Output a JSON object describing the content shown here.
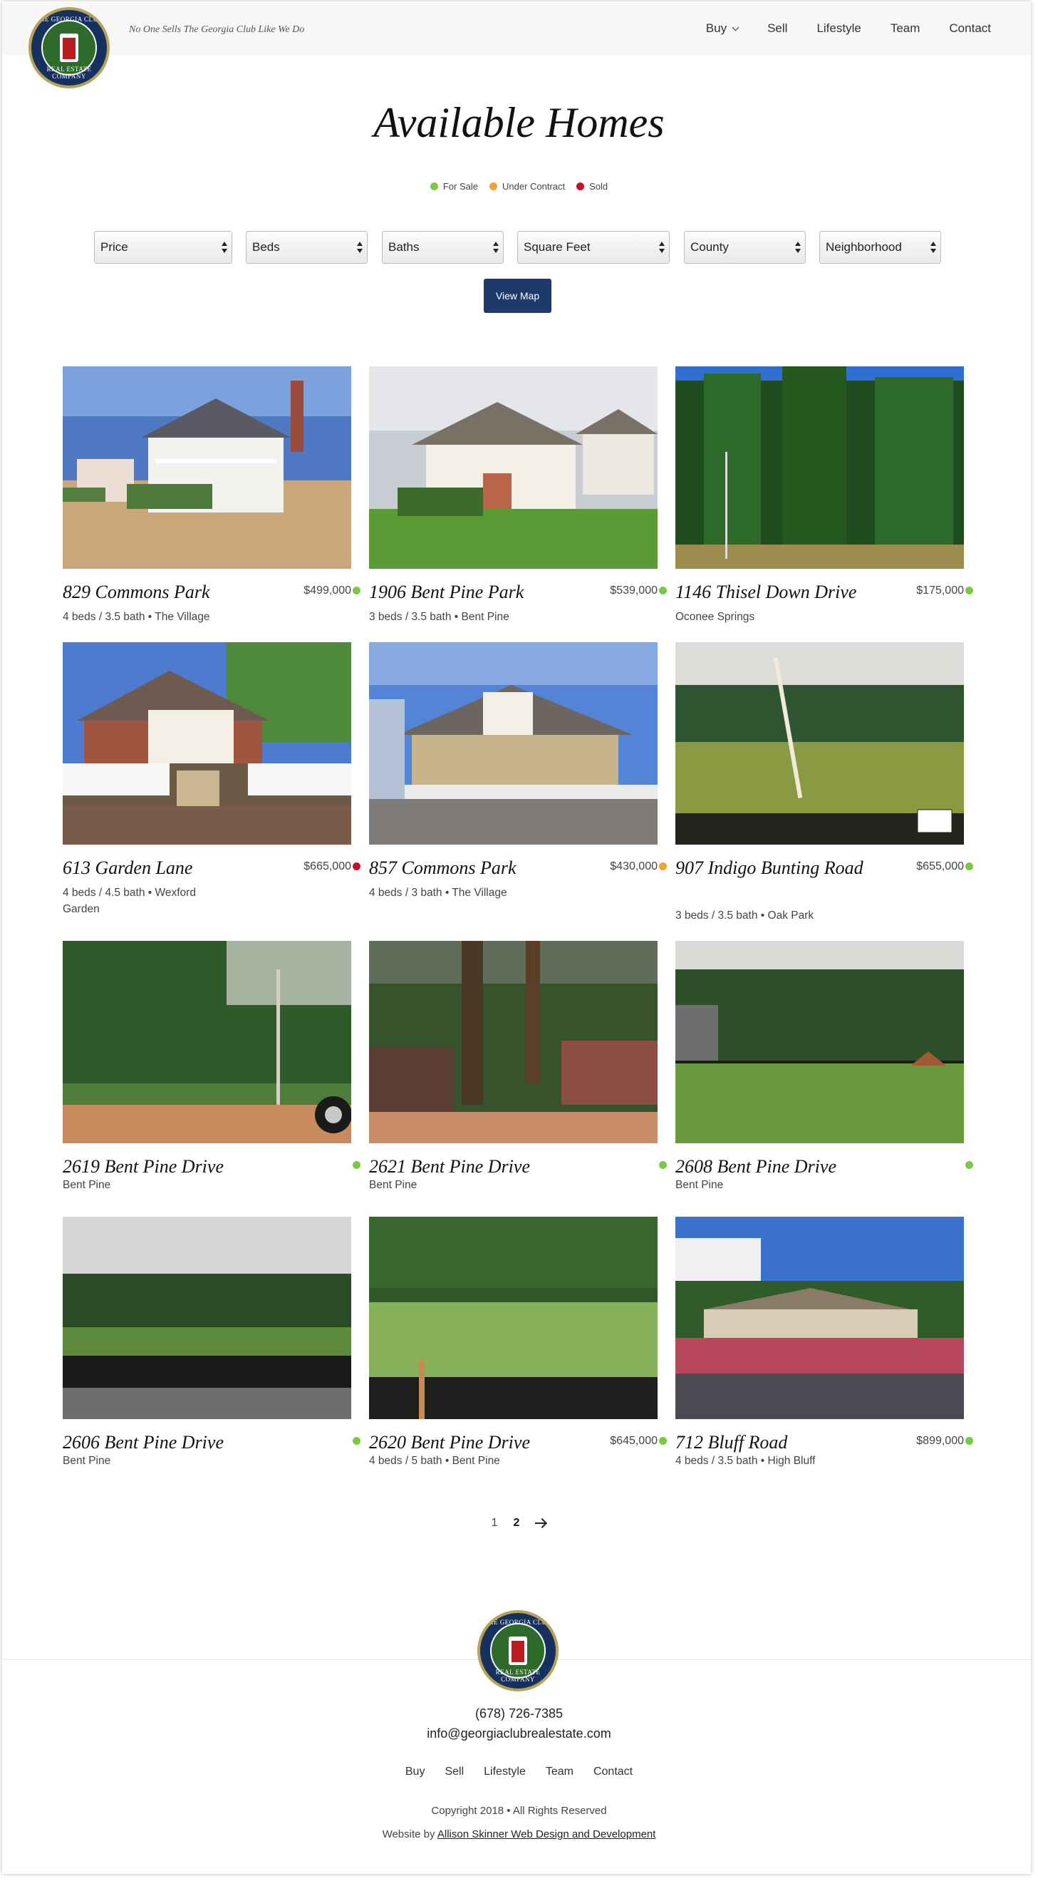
{
  "brand": {
    "logo_text_top": "THE GEORGIA CLUB",
    "logo_text_bottom": "REAL ESTATE COMPANY",
    "tagline": "No One Sells The Georgia Club Like We Do"
  },
  "nav": {
    "items": [
      {
        "label": "Buy",
        "has_dropdown": true
      },
      {
        "label": "Sell"
      },
      {
        "label": "Lifestyle"
      },
      {
        "label": "Team"
      },
      {
        "label": "Contact"
      }
    ]
  },
  "page": {
    "title": "Available Homes"
  },
  "legend": [
    {
      "label": "For Sale",
      "color": "#7ac943"
    },
    {
      "label": "Under Contract",
      "color": "#f0a22e"
    },
    {
      "label": "Sold",
      "color": "#c8102e"
    }
  ],
  "filters": [
    "Price",
    "Beds",
    "Baths",
    "Square Feet",
    "County",
    "Neighborhood"
  ],
  "view_map_label": "View Map",
  "status_colors": {
    "for_sale": "#7ac943",
    "under_contract": "#f0a22e",
    "sold": "#c8102e"
  },
  "listings": [
    {
      "address": "829 Commons Park",
      "price": "$499,000",
      "status": "for_sale",
      "details": "4 beds / 3.5 bath • The Village",
      "scene": "house-colonial"
    },
    {
      "address": "1906 Bent Pine Park",
      "price": "$539,000",
      "status": "for_sale",
      "details": "3 beds / 3.5 bath • Bent Pine",
      "scene": "house-craftsman"
    },
    {
      "address": "1146 Thisel Down Drive",
      "price": "$175,000",
      "status": "for_sale",
      "details": "Oconee Springs",
      "scene": "lot-pines"
    },
    {
      "address": "613 Garden Lane",
      "price": "$665,000",
      "status": "sold",
      "details": "4 beds / 4.5 bath • Wexford Garden",
      "scene": "house-picket"
    },
    {
      "address": "857 Commons Park",
      "price": "$430,000",
      "status": "under_contract",
      "details": "4 beds / 3 bath • The Village",
      "scene": "house-cottage"
    },
    {
      "address": "907 Indigo Bunting Road",
      "price": "$655,000",
      "status": "for_sale",
      "details": "3 beds / 3.5 bath • Oak Park",
      "scene": "lot-field"
    },
    {
      "address": "2619 Bent Pine Drive",
      "price": "",
      "status": "for_sale",
      "details": "Bent Pine",
      "scene": "lot-woods"
    },
    {
      "address": "2621 Bent Pine Drive",
      "price": "",
      "status": "for_sale",
      "details": "Bent Pine",
      "scene": "lot-woods-dense"
    },
    {
      "address": "2608 Bent Pine Drive",
      "price": "",
      "status": "for_sale",
      "details": "Bent Pine",
      "scene": "lot-grass"
    },
    {
      "address": "2606 Bent Pine Drive",
      "price": "",
      "status": "for_sale",
      "details": "Bent Pine",
      "scene": "lot-fence"
    },
    {
      "address": "2620 Bent Pine Drive",
      "price": "$645,000",
      "status": "for_sale",
      "details": "4 beds / 5 bath • Bent Pine",
      "scene": "lot-fence-green"
    },
    {
      "address": "712 Bluff Road",
      "price": "$899,000",
      "status": "for_sale",
      "details": "4 beds / 3.5 bath • High Bluff",
      "scene": "house-ranch"
    }
  ],
  "pagination": {
    "pages": [
      "1",
      "2"
    ],
    "current": "2"
  },
  "footer": {
    "phone": "(678) 726-7385",
    "email": "info@georgiaclubrealestate.com",
    "nav": [
      "Buy",
      "Sell",
      "Lifestyle",
      "Team",
      "Contact"
    ],
    "copyright": "Copyright 2018 • All Rights Reserved",
    "credit_prefix": "Website by",
    "credit_link": "Allison Skinner Web Design and Development"
  }
}
